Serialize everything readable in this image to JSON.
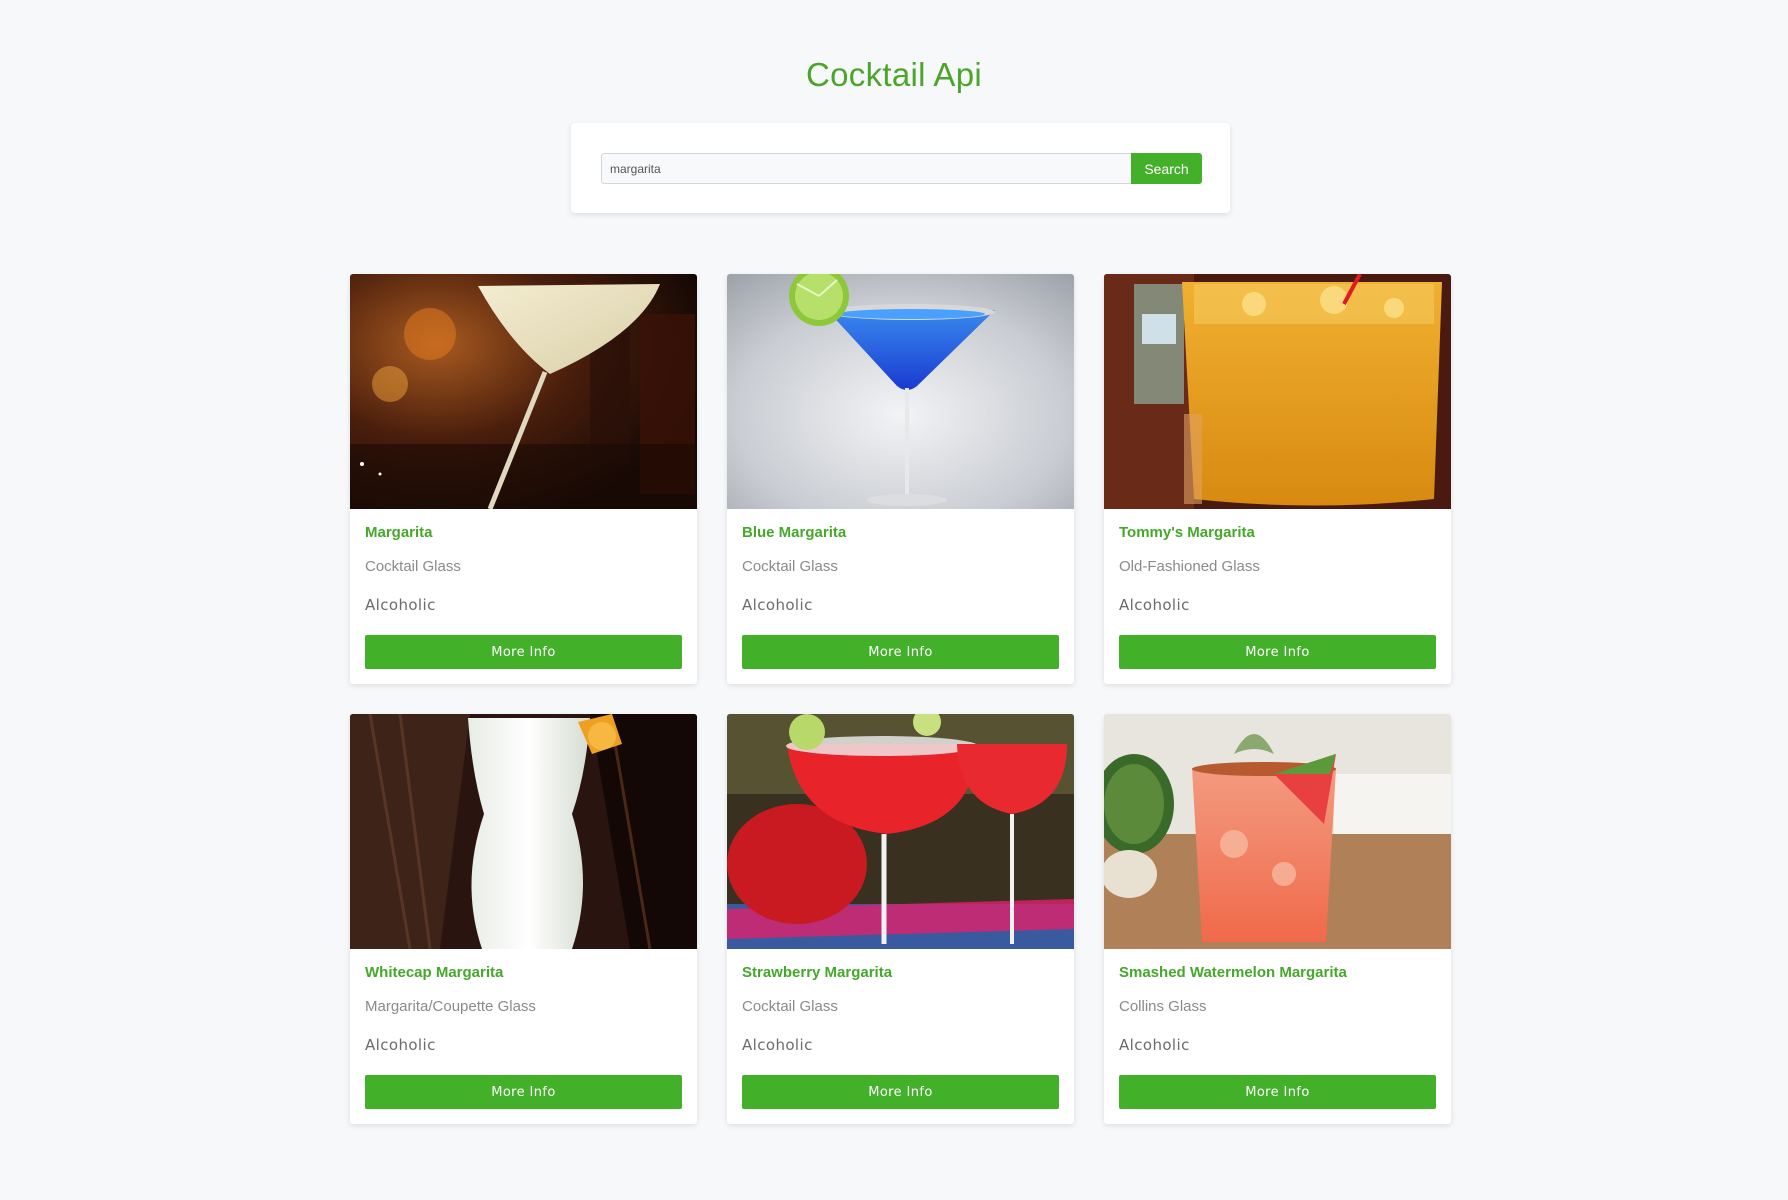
{
  "header": {
    "title": "Cocktail Api"
  },
  "search": {
    "value": "margarita",
    "button_label": "Search"
  },
  "colors": {
    "accent": "#42b029",
    "title": "#4aa52a",
    "background": "#f7f8fa"
  },
  "cocktails": [
    {
      "name": "Margarita",
      "glass": "Cocktail Glass",
      "type": "Alcoholic",
      "button_label": "More Info",
      "image": "margarita-cocktail-photo"
    },
    {
      "name": "Blue Margarita",
      "glass": "Cocktail Glass",
      "type": "Alcoholic",
      "button_label": "More Info",
      "image": "blue-margarita-photo"
    },
    {
      "name": "Tommy's Margarita",
      "glass": "Old-Fashioned Glass",
      "type": "Alcoholic",
      "button_label": "More Info",
      "image": "tommys-margarita-photo"
    },
    {
      "name": "Whitecap Margarita",
      "glass": "Margarita/Coupette Glass",
      "type": "Alcoholic",
      "button_label": "More Info",
      "image": "whitecap-margarita-photo"
    },
    {
      "name": "Strawberry Margarita",
      "glass": "Cocktail Glass",
      "type": "Alcoholic",
      "button_label": "More Info",
      "image": "strawberry-margarita-photo"
    },
    {
      "name": "Smashed Watermelon Margarita",
      "glass": "Collins Glass",
      "type": "Alcoholic",
      "button_label": "More Info",
      "image": "smashed-watermelon-margarita-photo"
    }
  ]
}
